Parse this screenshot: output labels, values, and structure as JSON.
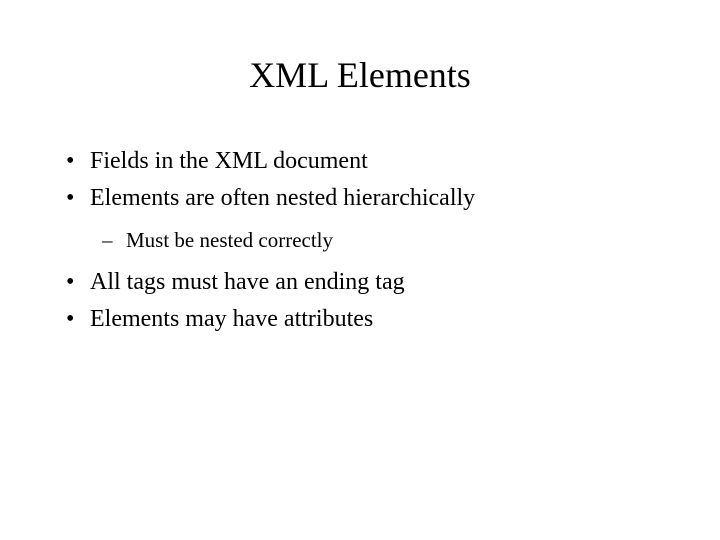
{
  "title": "XML Elements",
  "bullets": {
    "b0": "Fields in the XML document",
    "b1": "Elements are often nested hierarchically",
    "b1_sub0": "Must be nested correctly",
    "b2": "All tags must have an ending tag",
    "b3": "Elements may have attributes"
  }
}
